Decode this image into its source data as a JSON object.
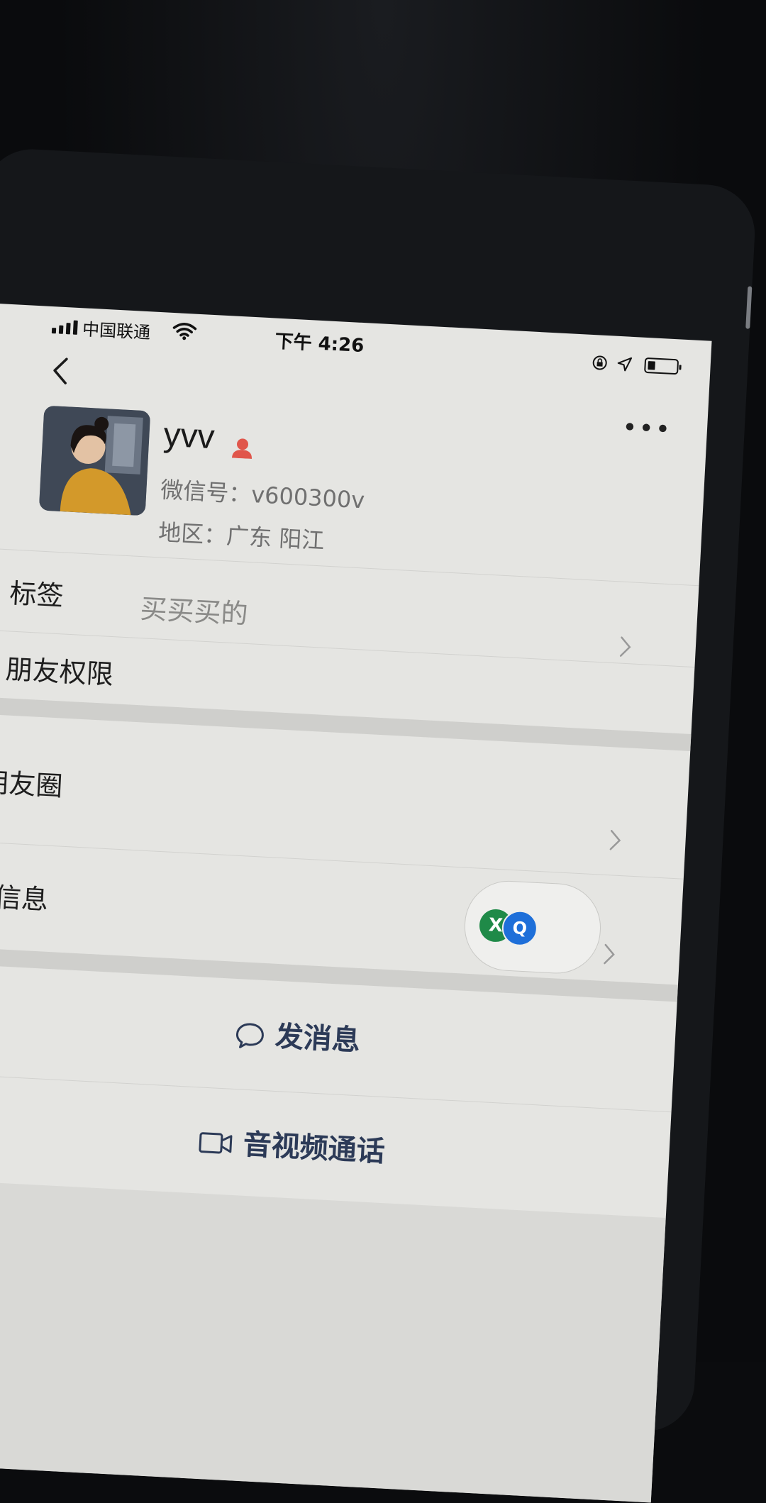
{
  "status_bar": {
    "carrier": "中国联通",
    "time": "下午 4:26"
  },
  "profile": {
    "name": "yvv",
    "wechat_id": "微信号：v600300v",
    "region": "地区：广东 阳江"
  },
  "rows": {
    "tags_label": "标签",
    "tags_value": "买买买的",
    "permissions_label": "朋友权限",
    "moments_label": "朋友圈",
    "more_info_label": "更多信息"
  },
  "actions": {
    "send_message": "发消息",
    "video_call": "音视频通话"
  },
  "float_ball": {
    "icon_left": "X",
    "icon_right": "Q"
  },
  "colors": {
    "accent_text": "#2c3a57",
    "gender_icon": "#e0564b",
    "float_green": "#1f8a48",
    "float_blue": "#1e6fd9"
  }
}
